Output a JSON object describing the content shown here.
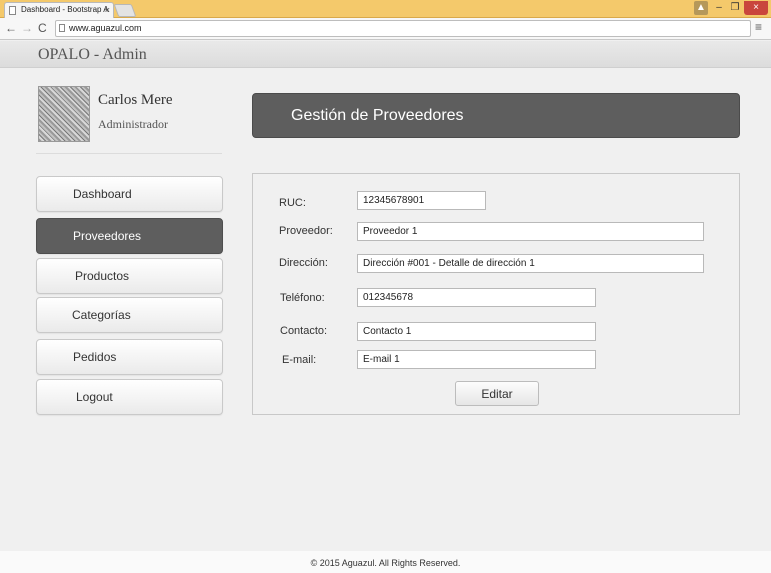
{
  "browser": {
    "tab_title": "Dashboard - Bootstrap A",
    "tab_close": "×",
    "url": "www.aguazul.com",
    "menu_glyph": "≡",
    "back_glyph": "←",
    "forward_glyph": "→",
    "reload_glyph": "C",
    "win_min_glyph": "–",
    "win_max_glyph": "❐",
    "win_close_glyph": "×",
    "win_user_glyph": "▲"
  },
  "header": {
    "brand": "OPALO - Admin"
  },
  "profile": {
    "name": "Carlos Mere",
    "role": "Administrador"
  },
  "sidebar": {
    "items": [
      {
        "label": "Dashboard"
      },
      {
        "label": "Proveedores"
      },
      {
        "label": "Productos"
      },
      {
        "label": "Categorías"
      },
      {
        "label": "Pedidos"
      },
      {
        "label": "Logout"
      }
    ]
  },
  "main": {
    "title": "Gestión de Proveedores",
    "form": {
      "ruc_label": "RUC:",
      "ruc_value": "12345678901",
      "proveedor_label": "Proveedor:",
      "proveedor_value": "Proveedor 1",
      "direccion_label": "Dirección:",
      "direccion_value": "Dirección #001 - Detalle de dirección 1",
      "telefono_label": "Teléfono:",
      "telefono_value": "012345678",
      "contacto_label": "Contacto:",
      "contacto_value": "Contacto 1",
      "email_label": "E-mail:",
      "email_value": "E-mail 1",
      "submit_label": "Editar"
    }
  },
  "footer": {
    "text": "© 2015 Aguazul. All Rights Reserved."
  },
  "colors": {
    "accent": "#5e5e5e",
    "titlebar": "#f4c96b",
    "background": "#f0f0f0"
  }
}
